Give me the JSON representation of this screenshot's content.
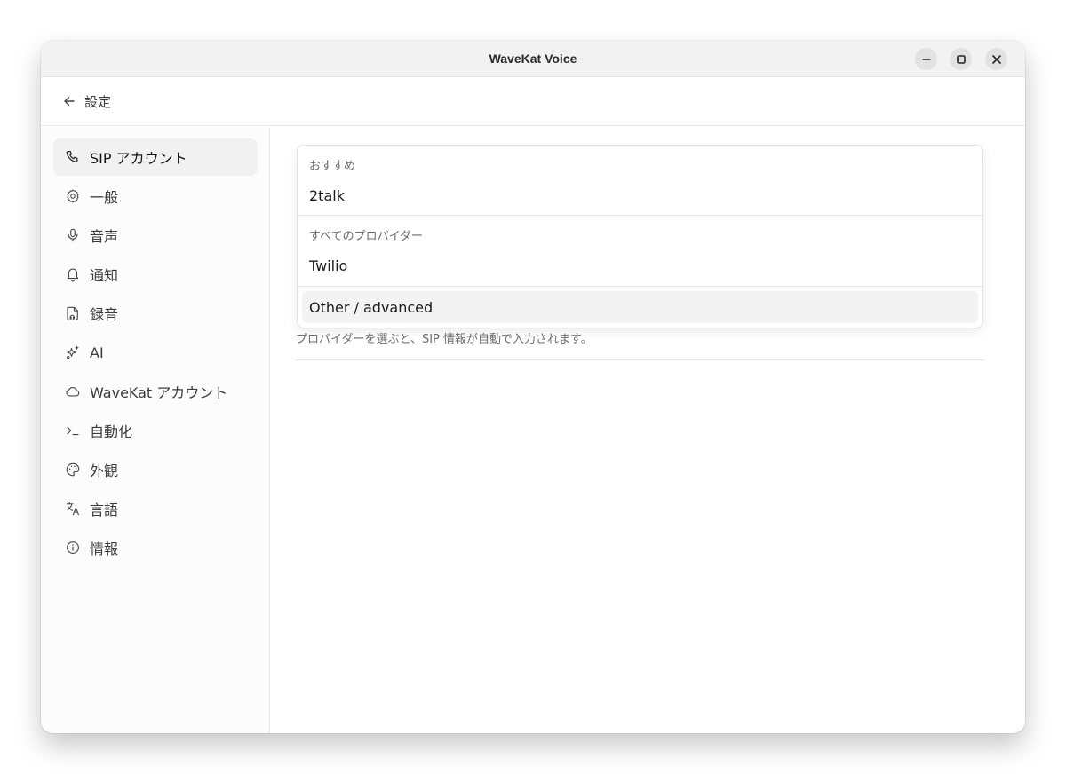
{
  "window": {
    "title": "WaveKat Voice"
  },
  "header": {
    "back_label": "設定"
  },
  "sidebar": {
    "items": [
      {
        "label": "SIP アカウント",
        "icon": "phone-icon"
      },
      {
        "label": "一般",
        "icon": "gear-icon"
      },
      {
        "label": "音声",
        "icon": "microphone-icon"
      },
      {
        "label": "通知",
        "icon": "bell-icon"
      },
      {
        "label": "録音",
        "icon": "recording-file-icon"
      },
      {
        "label": "AI",
        "icon": "sparkles-icon"
      },
      {
        "label": "WaveKat アカウント",
        "icon": "cloud-icon"
      },
      {
        "label": "自動化",
        "icon": "terminal-icon"
      },
      {
        "label": "外観",
        "icon": "palette-icon"
      },
      {
        "label": "言語",
        "icon": "translate-icon"
      },
      {
        "label": "情報",
        "icon": "info-icon"
      }
    ]
  },
  "provider_dropdown": {
    "groups": [
      {
        "label": "おすすめ",
        "options": [
          "2talk"
        ]
      },
      {
        "label": "すべてのプロバイダー",
        "options": [
          "Twilio"
        ]
      },
      {
        "label": "",
        "options": [
          "Other / advanced"
        ]
      }
    ],
    "highlighted_option": "Other / advanced"
  },
  "main": {
    "hint": "プロバイダーを選ぶと、SIP 情報が自動で入力されます。"
  }
}
